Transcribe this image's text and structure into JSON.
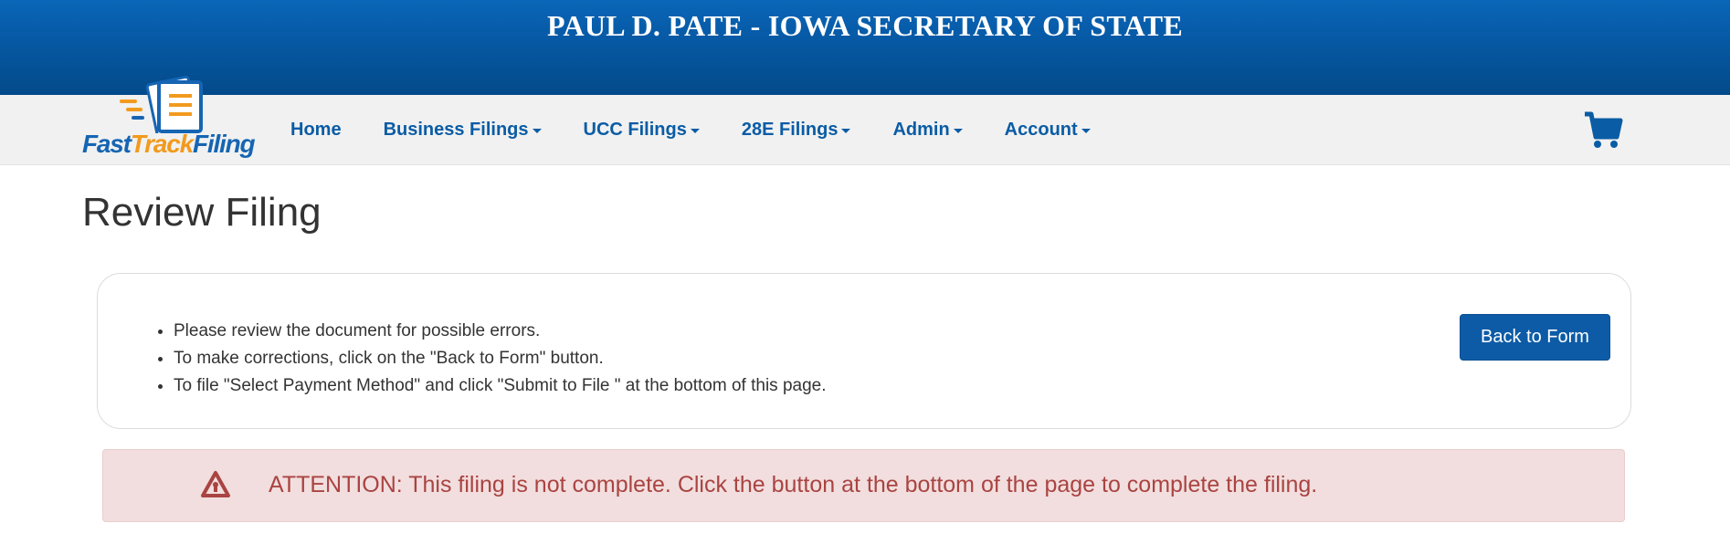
{
  "header": {
    "title": "PAUL D. PATE - IOWA SECRETARY OF STATE"
  },
  "logo": {
    "part1": "Fast",
    "part2": "Track",
    "part3": "Filing"
  },
  "nav": {
    "items": [
      {
        "label": "Home",
        "has_dropdown": false
      },
      {
        "label": "Business Filings",
        "has_dropdown": true
      },
      {
        "label": "UCC Filings",
        "has_dropdown": true
      },
      {
        "label": "28E Filings",
        "has_dropdown": true
      },
      {
        "label": "Admin",
        "has_dropdown": true
      },
      {
        "label": "Account",
        "has_dropdown": true
      }
    ],
    "cart_icon": "shopping-cart-icon"
  },
  "page": {
    "title": "Review Filing"
  },
  "review": {
    "instructions": [
      "Please review the document for possible errors.",
      "To make corrections, click on the \"Back to Form\" button.",
      "To file \"Select Payment Method\" and click \"Submit to File \" at the bottom of this page."
    ],
    "back_button_label": "Back to Form"
  },
  "alert": {
    "icon": "warning-icon",
    "text": "ATTENTION: This filing is not complete. Click the button at the bottom of the page to complete the filing."
  },
  "colors": {
    "header_blue": "#0658a3",
    "nav_link": "#0a5ca5",
    "button_blue": "#0d5ba6",
    "alert_bg": "#f2dede",
    "alert_text": "#a94442",
    "logo_orange": "#f29a1e"
  }
}
